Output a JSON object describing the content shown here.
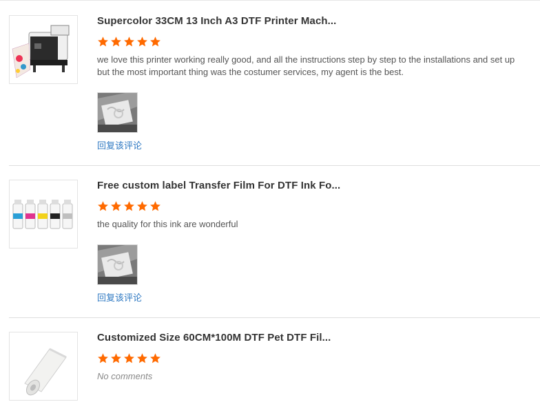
{
  "reviews": [
    {
      "product_title": "Supercolor 33CM 13 Inch A3 DTF Printer Mach...",
      "rating": 5,
      "comment_lines": [
        "we love this printer working really good, and all the instructions step by step to the installations and set up",
        "but the most important thing was the costumer services, my agent is the best."
      ],
      "has_photo": true,
      "reply_label": "回复该评论"
    },
    {
      "product_title": "Free custom label Transfer Film For DTF Ink Fo...",
      "rating": 5,
      "comment_lines": [
        "the quality for this ink are wonderful"
      ],
      "has_photo": true,
      "reply_label": "回复该评论"
    },
    {
      "product_title": "Customized Size 60CM*100M DTF Pet DTF Fil...",
      "rating": 5,
      "comment_lines": [
        "No comments"
      ],
      "has_photo": false
    }
  ],
  "colors": {
    "star": "#ff6a00",
    "link": "#2f79c2",
    "divider": "#dedede"
  }
}
